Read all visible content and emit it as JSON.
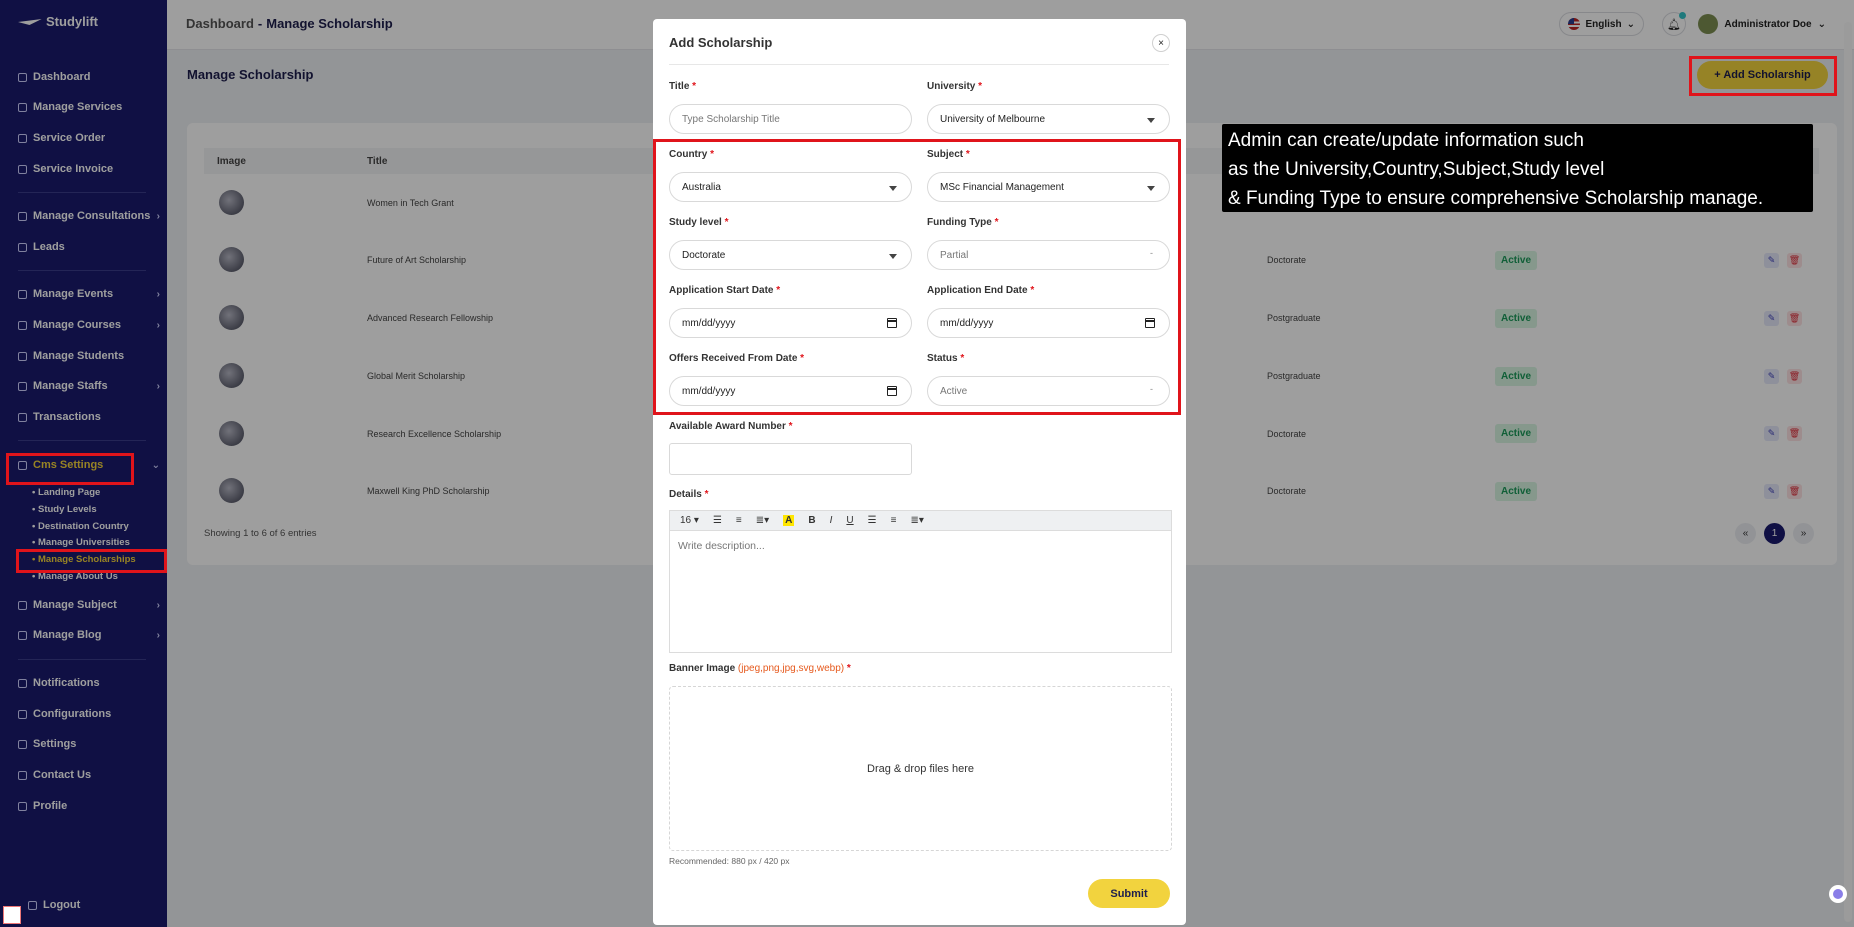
{
  "brand": "Studylift",
  "sidebar": {
    "items": [
      {
        "label": "Dashboard",
        "icon": "grid-icon"
      },
      {
        "label": "Manage Services",
        "icon": "settings-icon"
      },
      {
        "label": "Service Order",
        "icon": "list-icon"
      },
      {
        "label": "Service Invoice",
        "icon": "invoice-icon"
      },
      {
        "label": "Manage Consultations",
        "icon": "calendar-icon"
      },
      {
        "label": "Leads",
        "icon": "lead-icon"
      },
      {
        "label": "Manage Events",
        "icon": "event-icon"
      },
      {
        "label": "Manage Courses",
        "icon": "book-icon"
      },
      {
        "label": "Manage Students",
        "icon": "students-icon"
      },
      {
        "label": "Manage Staffs",
        "icon": "staff-icon"
      },
      {
        "label": "Transactions",
        "icon": "transaction-icon"
      },
      {
        "label": "Cms Settings",
        "icon": "cms-icon"
      },
      {
        "label": "Manage Subject",
        "icon": "subject-icon"
      },
      {
        "label": "Manage Blog",
        "icon": "blog-icon"
      },
      {
        "label": "Notifications",
        "icon": "bell-icon"
      },
      {
        "label": "Configurations",
        "icon": "config-icon"
      },
      {
        "label": "Settings",
        "icon": "gear-icon"
      },
      {
        "label": "Contact Us",
        "icon": "contact-icon"
      },
      {
        "label": "Profile",
        "icon": "user-icon"
      }
    ],
    "cms_sub": [
      "Landing Page",
      "Study Levels",
      "Destination Country",
      "Manage Universities",
      "Manage Scholarships",
      "Manage About Us"
    ],
    "logout": "Logout"
  },
  "header": {
    "crumb_root": "Dashboard",
    "crumb_sep": "-",
    "crumb_page": "Manage Scholarship",
    "language": "English",
    "user": "Administrator Doe"
  },
  "page": {
    "title": "Manage Scholarship",
    "add_button": "+ Add Scholarship",
    "columns": [
      "Image",
      "Title"
    ],
    "rows": [
      {
        "title": "Women in Tech Grant",
        "level": "",
        "status": ""
      },
      {
        "title": "Future of Art Scholarship",
        "level": "Doctorate",
        "status": "Active"
      },
      {
        "title": "Advanced Research Fellowship",
        "level": "Postgraduate",
        "status": "Active"
      },
      {
        "title": "Global Merit Scholarship",
        "level": "Postgraduate",
        "status": "Active"
      },
      {
        "title": "Research Excellence Scholarship",
        "level": "Doctorate",
        "status": "Active"
      },
      {
        "title": "Maxwell King PhD Scholarship",
        "level": "Doctorate",
        "status": "Active"
      }
    ],
    "entries": "Showing 1 to 6 of 6 entries",
    "pager": {
      "prev": "«",
      "current": "1",
      "next": "»"
    }
  },
  "modal": {
    "title": "Add Scholarship",
    "close": "×",
    "title_label": "Title",
    "title_placeholder": "Type Scholarship Title",
    "university_label": "University",
    "university_value": "University of Melbourne",
    "country_label": "Country",
    "country_value": "Australia",
    "subject_label": "Subject",
    "subject_value": "MSc Financial Management",
    "study_level_label": "Study level",
    "study_level_value": "Doctorate",
    "funding_label": "Funding Type",
    "funding_value": "Partial",
    "app_start_label": "Application Start Date",
    "app_end_label": "Application End Date",
    "offers_label": "Offers Received From Date",
    "status_label": "Status",
    "status_value": "Active",
    "date_placeholder": "mm/dd/yyyy",
    "award_label": "Available Award Number",
    "details_label": "Details",
    "editor_font_size": "16",
    "editor_placeholder": "Write description...",
    "banner_label": "Banner Image",
    "banner_hint": "(jpeg,png,jpg,svg,webp)",
    "dropzone": "Drag & drop files here",
    "recommended": "Recommended: 880 px / 420 px",
    "submit": "Submit",
    "required_mark": "*"
  },
  "tooltip": {
    "line1": "Admin can create/update information such",
    "line2": "as the University,Country,Subject,Study level",
    "line3": " & Funding Type to ensure comprehensive Scholarship manage."
  },
  "colors": {
    "sidebar": "#1a1b6e",
    "accent": "#f2d33e",
    "highlight": "#e0141b",
    "active_badge": "#1b9a5a"
  }
}
